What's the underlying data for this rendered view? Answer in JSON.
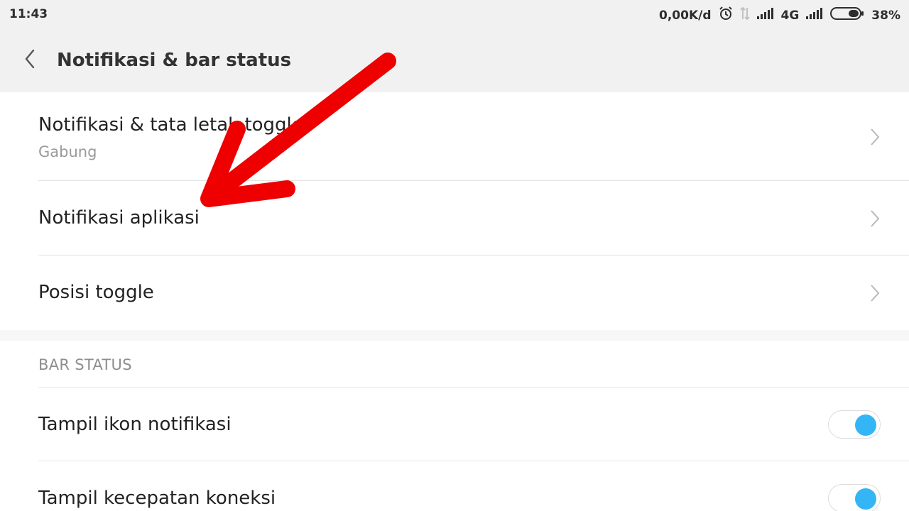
{
  "status_bar": {
    "time": "11:43",
    "net_speed": "0,00K/d",
    "network_type": "4G",
    "battery_percent": "38%",
    "battery_level": 0.38,
    "icons": [
      "alarm-icon",
      "data-transfer-icon",
      "signal-icon",
      "signal-icon",
      "battery-icon"
    ]
  },
  "header": {
    "title": "Notifikasi & bar status",
    "back_icon": "back-icon"
  },
  "section_1": {
    "items": [
      {
        "label": "Notifikasi & tata letak toggle",
        "sublabel": "Gabung",
        "icon": "chevron-right-icon"
      },
      {
        "label": "Notifikasi aplikasi",
        "icon": "chevron-right-icon"
      },
      {
        "label": "Posisi toggle",
        "icon": "chevron-right-icon"
      }
    ]
  },
  "section_2": {
    "header": "BAR STATUS",
    "items": [
      {
        "label": "Tampil ikon notifikasi",
        "toggle_on": true
      },
      {
        "label": "Tampil kecepatan koneksi",
        "toggle_on": true
      }
    ]
  },
  "colors": {
    "toggle_on": "#33b5f6",
    "annotation_arrow": "#ee0000",
    "header_bg": "#f1f1f1"
  }
}
